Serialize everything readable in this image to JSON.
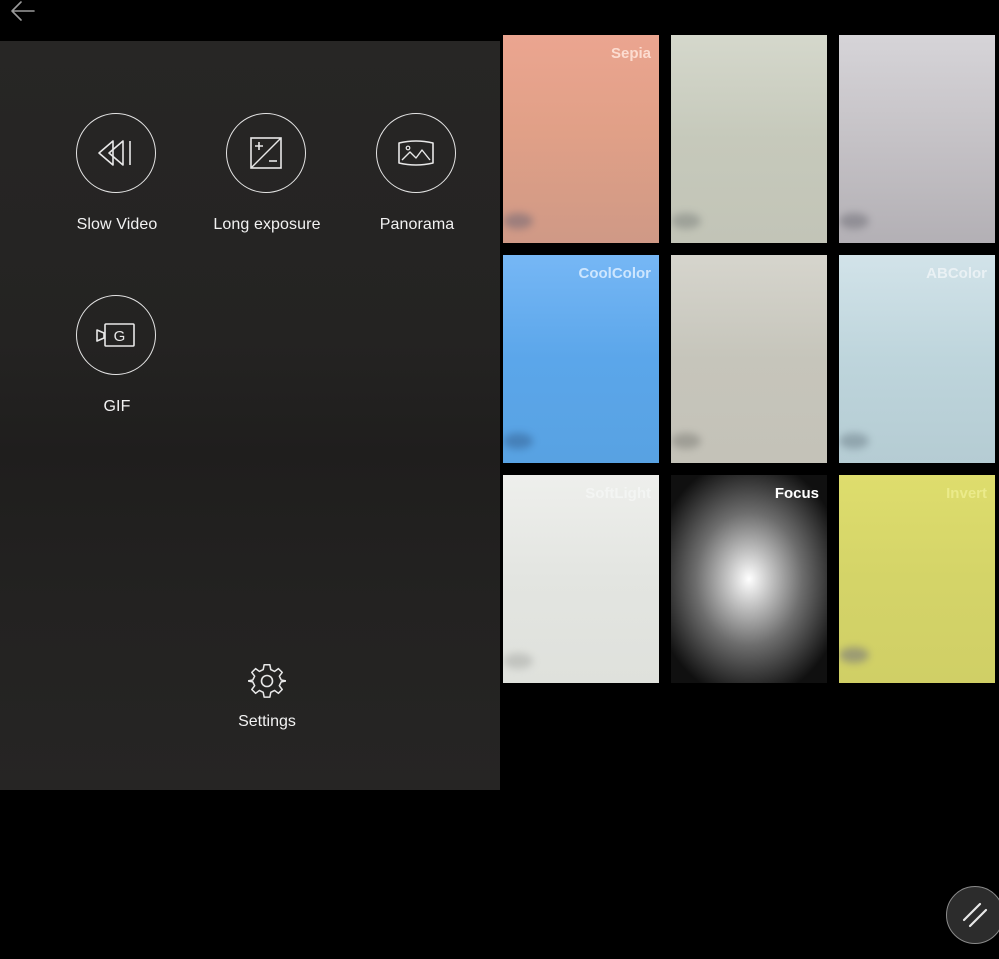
{
  "nav": {
    "back_icon": "arrow-left-icon"
  },
  "modes": [
    {
      "label": "Slow Video",
      "icon": "rewind-icon"
    },
    {
      "label": "Long exposure",
      "icon": "exposure-icon"
    },
    {
      "label": "Panorama",
      "icon": "panorama-icon"
    },
    {
      "label": "GIF",
      "icon": "gif-camera-icon"
    }
  ],
  "settings": {
    "label": "Settings",
    "icon": "gear-icon"
  },
  "filters": [
    {
      "label": "Sepia",
      "color": "#e8a58e"
    },
    {
      "label": "",
      "color": "#c9ccbf"
    },
    {
      "label": "",
      "color": "#c7c4c8"
    },
    {
      "label": "CoolColor",
      "color": "#5ba7ec"
    },
    {
      "label": "",
      "color": "#c6c5bc"
    },
    {
      "label": "ABColor",
      "color": "#bed5dc"
    },
    {
      "label": "SoftLight",
      "color": "#e4e6e2"
    },
    {
      "label": "Focus",
      "color": "#000000"
    },
    {
      "label": "Invert",
      "color": "#d4d468"
    }
  ],
  "colors": {
    "panel_bg": "#242322",
    "screen_bg": "#000000",
    "label_text": "#f2f2f2",
    "icon_stroke": "#e4e4e4"
  },
  "fab": {
    "icon": "diagonal-lines-icon"
  }
}
